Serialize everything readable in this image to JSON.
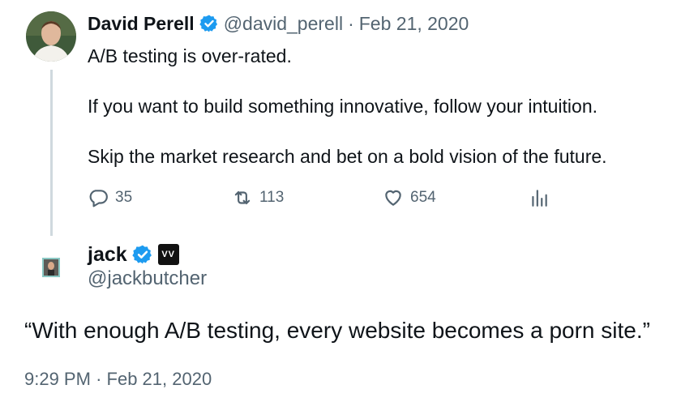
{
  "parent_tweet": {
    "author_name": "David Perell",
    "handle": "@david_perell",
    "separator": "·",
    "date": "Feb 21, 2020",
    "lines": [
      "A/B testing is over-rated.",
      "If you want to build something innovative, follow your intuition.",
      "Skip the market research and bet on a bold vision of the future."
    ],
    "replies": "35",
    "retweets": "113",
    "likes": "654"
  },
  "reply_tweet": {
    "author_name": "jack",
    "handle": "@jackbutcher",
    "logo_text": "VV",
    "text": "“With enough A/B testing, every website becomes a porn site.”",
    "time": "9:29 PM",
    "separator": "·",
    "date": "Feb 21, 2020"
  },
  "colors": {
    "verified": "#1d9bf0",
    "secondary_text": "#536471",
    "thread_line": "#cfd9de"
  }
}
